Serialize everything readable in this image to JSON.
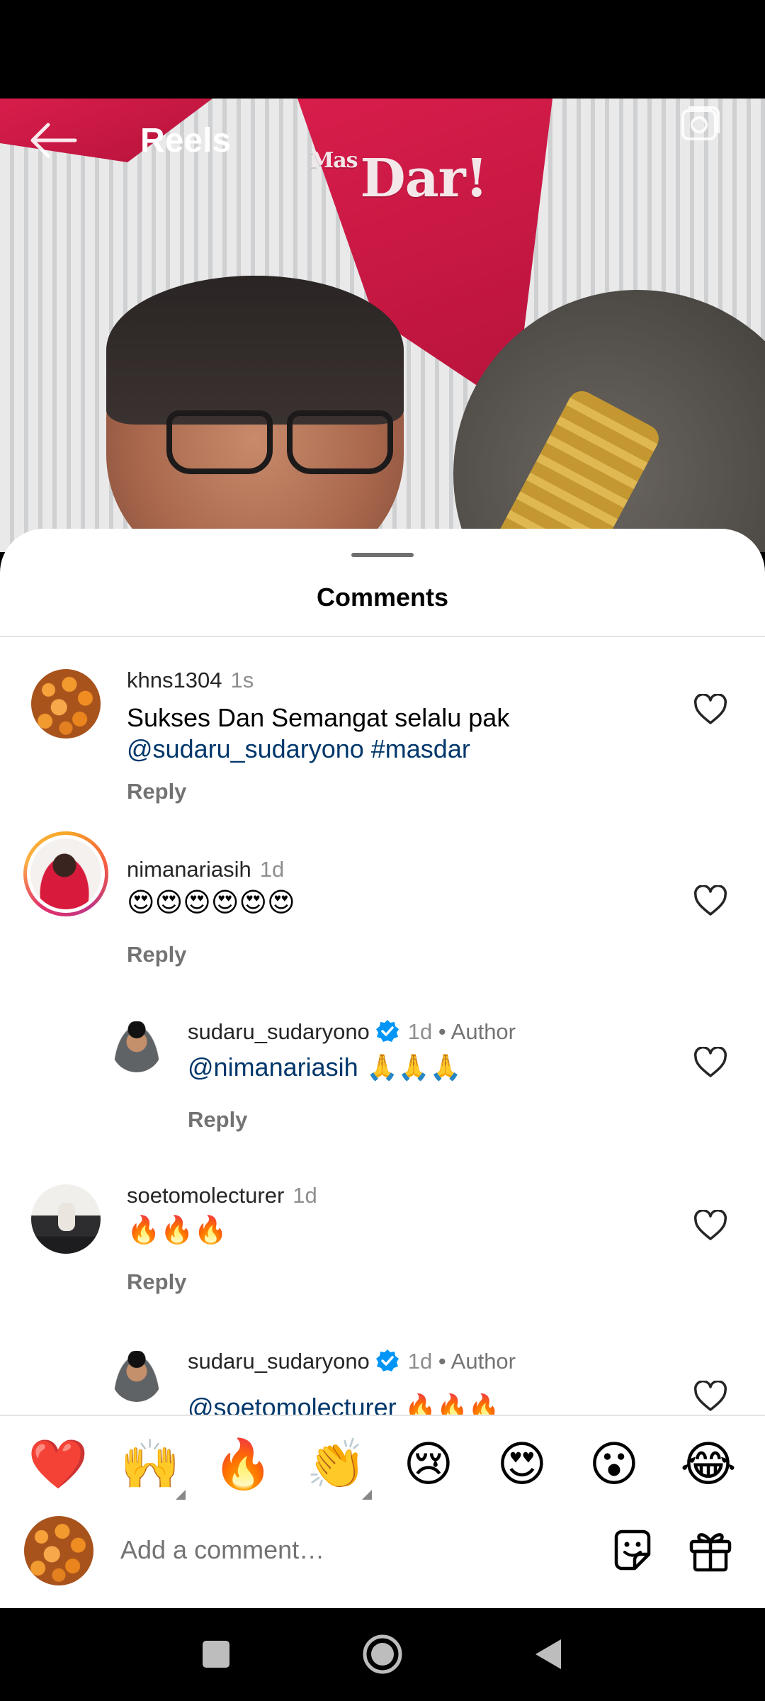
{
  "header": {
    "title": "Reels",
    "video_logo": "Dar!",
    "video_logo_prefix": "Mas"
  },
  "sheet": {
    "title": "Comments"
  },
  "comments": [
    {
      "user": "khns1304",
      "time": "1s",
      "text": "Sukses Dan Semangat selalu pak",
      "mentions": "@sudaru_sudaryono  #masdar",
      "reply": "Reply"
    },
    {
      "user": "nimanariasih",
      "time": "1d",
      "text": "😍😍😍😍😍😍",
      "reply": "Reply"
    },
    {
      "user": "sudaru_sudaryono",
      "time": "1d",
      "author": "• Author",
      "mention": "@nimanariasih",
      "text": " 🙏🙏🙏",
      "reply": "Reply"
    },
    {
      "user": "soetomolecturer",
      "time": "1d",
      "text": "🔥🔥🔥",
      "reply": "Reply"
    },
    {
      "user": "sudaru_sudaryono",
      "time": "1d",
      "author": "• Author",
      "mention": "@soetomolecturer",
      "text": " 🔥🔥🔥"
    }
  ],
  "reactions": [
    "❤️",
    "🙌",
    "🔥",
    "👏",
    "😢",
    "😍",
    "😮",
    "😂"
  ],
  "compose": {
    "placeholder": "Add a comment…"
  },
  "colors": {
    "mention": "#00376b",
    "verified": "#0095f6",
    "heart_red": "#ed4956"
  },
  "icons": [
    "back-arrow-icon",
    "camera-icon",
    "heart-icon",
    "verified-icon",
    "sticker-icon",
    "gift-icon",
    "recents-icon",
    "home-icon",
    "back-triangle-icon"
  ]
}
